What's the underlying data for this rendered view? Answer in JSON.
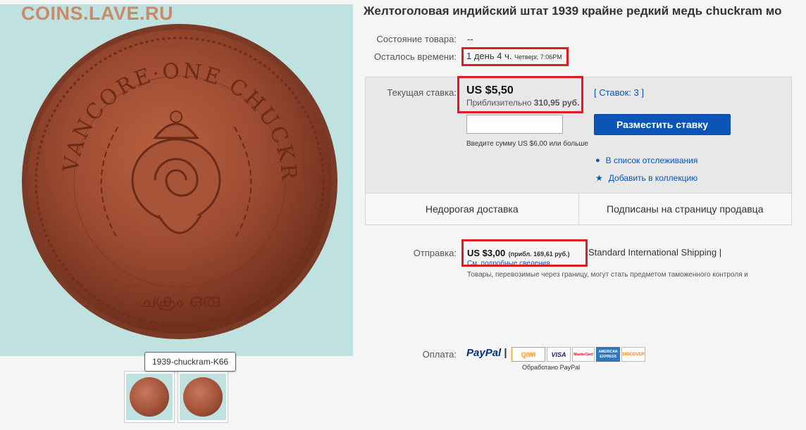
{
  "watermark": "COINS.LAVE.RU",
  "image": {
    "coin_top_text": "TRAVANCORE·ONE CHUCKRAM",
    "tooltip": "1939-chuckram-K66"
  },
  "listing": {
    "title": "Желтоголовая индийский штат 1939 крайне редкий медь chuckram мо",
    "condition_label": "Состояние товара:",
    "condition_value": "--",
    "time_left_label": "Осталось времени:",
    "time_left_value": "1 день 4 ч.",
    "time_left_detail": "Четверг, 7:06PM"
  },
  "bid": {
    "current_label": "Текущая ставка:",
    "current_price": "US $5,50",
    "approx_prefix": "Приблизительно",
    "approx_value": "310,95 руб.",
    "bids_link": "[ Ставок: 3 ]",
    "input_value": "",
    "place_bid_button": "Разместить ставку",
    "hint": "Введите сумму US $6,00 или больше",
    "watchlist_link": "В список отслеживания",
    "collection_link": "Добавить в коллекцию",
    "footer_left": "Недорогая доставка",
    "footer_right": "Подписаны на страницу продавца"
  },
  "shipping": {
    "label": "Отправка:",
    "price": "US $3,00",
    "approx": "(прибл. 169,61 руб.)",
    "method": "Standard International Shipping |",
    "details_link": "См. подробные сведения",
    "customs_note": "Товары, перевозимые через границу, могут стать предметом таможенного контроля и"
  },
  "payment": {
    "label": "Оплата:",
    "paypal": "PayPal",
    "qiwi": "QIWI",
    "visa": "VISA",
    "mastercard": "MasterCard",
    "amex": "AMERICAN EXPRESS",
    "discover": "DISCOVER",
    "processed": "Обработано PayPal"
  },
  "colors": {
    "accent_red": "#e01b22",
    "button_blue": "#0a55b5",
    "link_blue": "#0654ba"
  }
}
